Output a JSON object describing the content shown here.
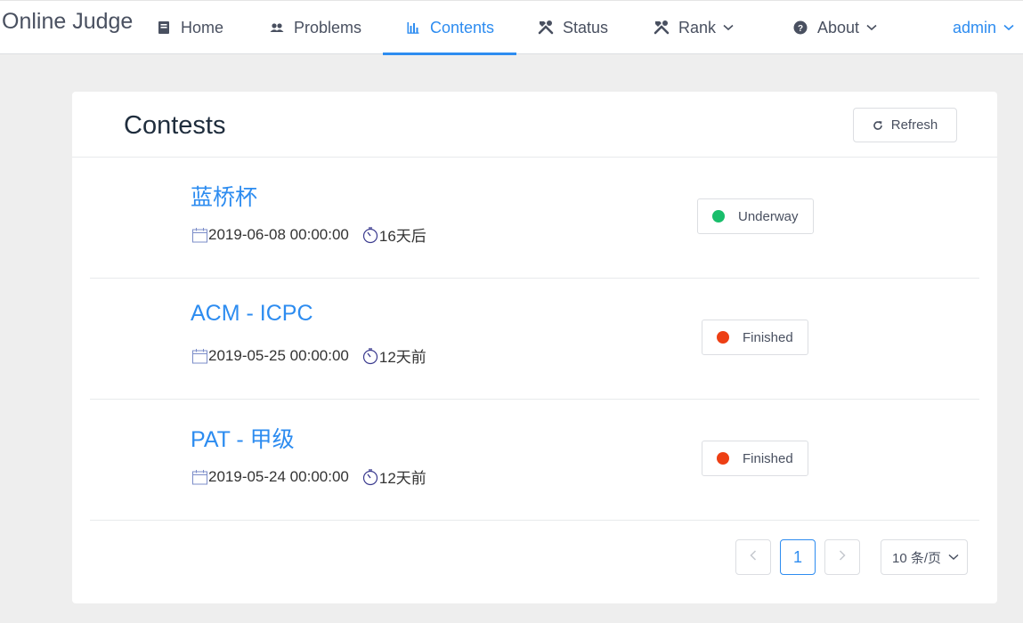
{
  "nav": {
    "brand": "Online Judge",
    "items": [
      {
        "label": "Home",
        "icon": "book-icon"
      },
      {
        "label": "Problems",
        "icon": "users-icon"
      },
      {
        "label": "Contents",
        "icon": "bar-chart-icon",
        "active": true
      },
      {
        "label": "Status",
        "icon": "tools-icon"
      },
      {
        "label": "Rank",
        "icon": "tools-icon",
        "dropdown": true
      },
      {
        "label": "About",
        "icon": "help-icon",
        "dropdown": true
      }
    ],
    "user": "admin"
  },
  "contests": {
    "title": "Contests",
    "refresh_label": "Refresh",
    "items": [
      {
        "name": "蓝桥杯",
        "start_time": "2019-06-08 00:00:00",
        "relative": "16天后",
        "status": "Underway",
        "status_color": "#19be6b"
      },
      {
        "name": "ACM - ICPC",
        "start_time": "2019-05-25 00:00:00",
        "relative": "12天前",
        "status": "Finished",
        "status_color": "#ed3f14"
      },
      {
        "name": "PAT - 甲级",
        "start_time": "2019-05-24 00:00:00",
        "relative": "12天前",
        "status": "Finished",
        "status_color": "#ed3f14"
      }
    ]
  },
  "pagination": {
    "current_page": "1",
    "page_size": "10 条/页"
  },
  "colors": {
    "accent": "#2d8cf0",
    "text": "#495060",
    "background": "#eeeeee"
  }
}
